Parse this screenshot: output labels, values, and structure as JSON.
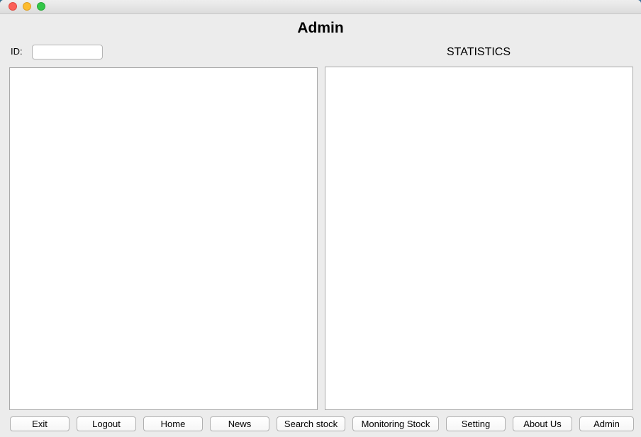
{
  "window": {
    "title": "Admin"
  },
  "form": {
    "id_label": "ID:",
    "id_value": ""
  },
  "statistics": {
    "title": "STATISTICS"
  },
  "buttons": [
    {
      "label": "Exit"
    },
    {
      "label": "Logout"
    },
    {
      "label": "Home"
    },
    {
      "label": "News"
    },
    {
      "label": "Search stock"
    },
    {
      "label": "Monitoring Stock"
    },
    {
      "label": "Setting"
    },
    {
      "label": "About Us"
    },
    {
      "label": "Admin"
    }
  ],
  "colors": {
    "window_bg": "#ececec",
    "panel_bg": "#ffffff",
    "close": "#fc5f57",
    "minimize": "#fdbc2e",
    "zoom": "#33c748"
  }
}
